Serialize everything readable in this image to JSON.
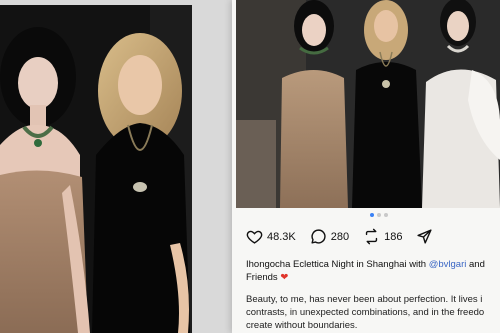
{
  "post": {
    "stats": {
      "likes": "48.3K",
      "comments": "280",
      "reposts": "186"
    },
    "caption": {
      "text": "Ihongocha Eclettica Night in Shanghai with",
      "mention": "@bvlgari",
      "after_mention": "and",
      "line2": "Friends",
      "heart": "❤"
    },
    "body": {
      "line1": "Beauty, to me, has never been about perfection. It lives i",
      "line2": "contrasts, in unexpected combinations, and in the freedo",
      "line3": "create without boundaries."
    }
  },
  "icons": {
    "like": "heart-icon",
    "comment": "comment-icon",
    "repost": "repost-icon",
    "share": "send-icon"
  },
  "colors": {
    "mention": "#3b67c4",
    "heart": "#e0352b",
    "active_dot": "#3b82f6"
  }
}
